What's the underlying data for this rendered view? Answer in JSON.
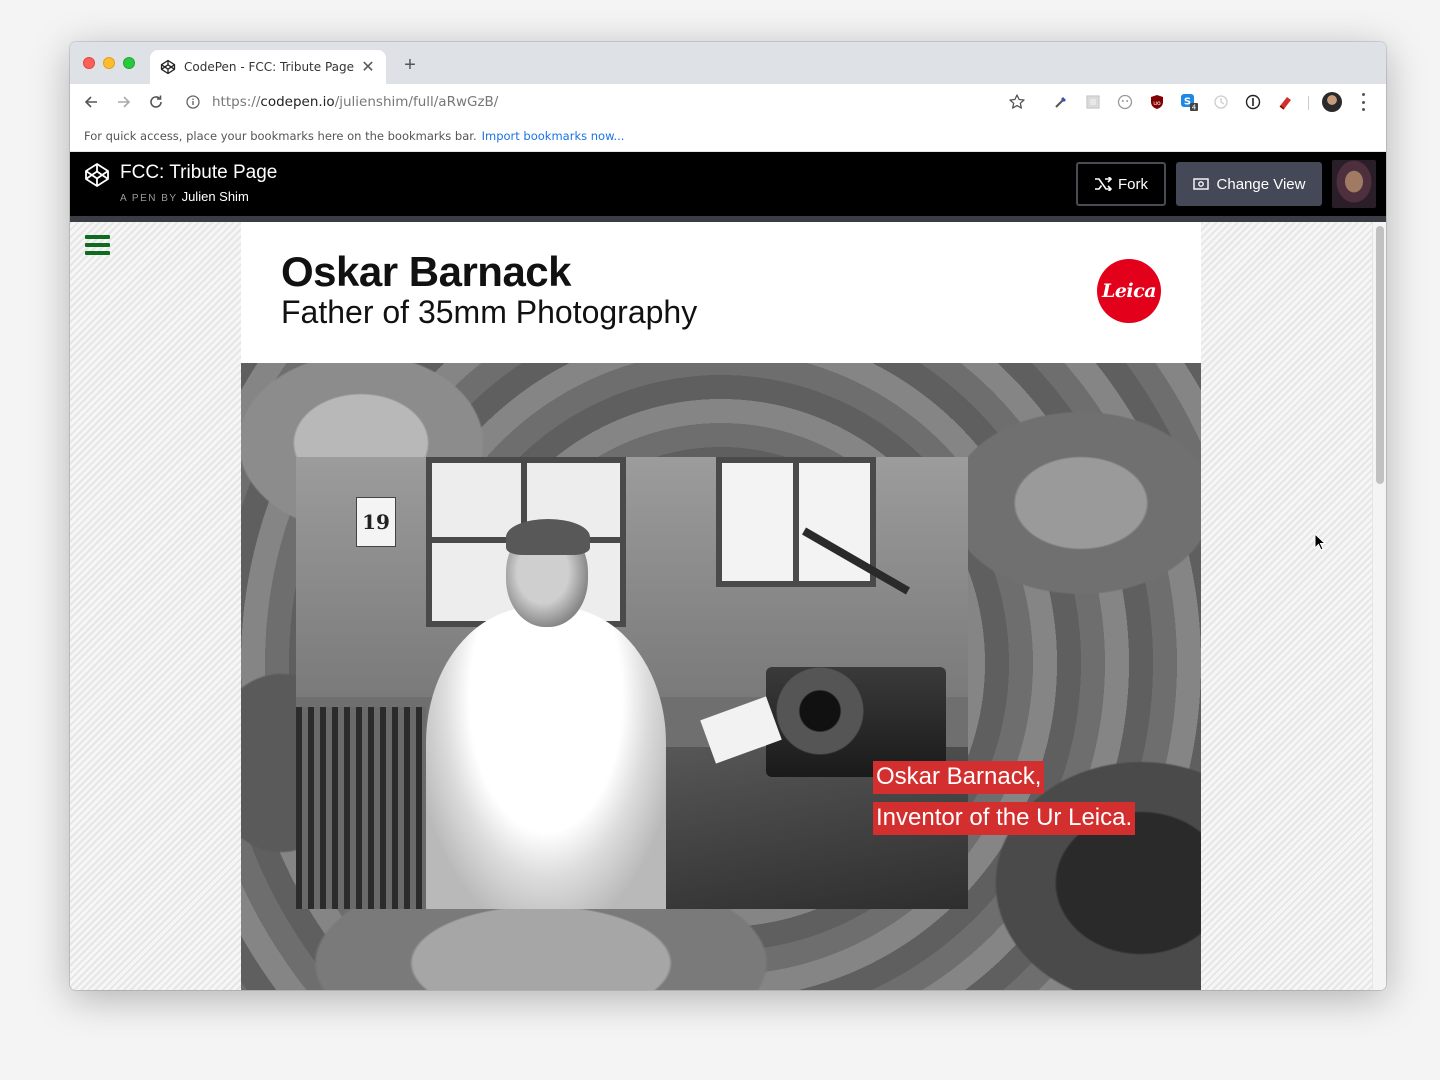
{
  "browser": {
    "tab_title": "CodePen - FCC: Tribute Page",
    "url_prefix": "https://",
    "url_host": "codepen.io",
    "url_path": "/julienshim/full/aRwGzB/",
    "bookmarks_text": "For quick access, place your bookmarks here on the bookmarks bar.",
    "bookmarks_link": "Import bookmarks now...",
    "extension_badge": "4"
  },
  "codepen": {
    "pen_title": "FCC: Tribute Page",
    "author_prefix": "A PEN BY",
    "author_name": "Julien Shim",
    "fork_label": "Fork",
    "change_view_label": "Change View"
  },
  "page": {
    "title": "Oskar Barnack",
    "subtitle": "Father of 35mm Photography",
    "logo_text": "Leica",
    "caption_line1": "Oskar Barnack,",
    "caption_line2": "Inventor of the Ur Leica.",
    "calendar_number": "19"
  },
  "colors": {
    "hamburger": "#0f6b1d",
    "caption_bg": "#d32f2f",
    "leica_red": "#e2001a",
    "codepen_header": "#000000",
    "change_view_bg": "#444857"
  }
}
